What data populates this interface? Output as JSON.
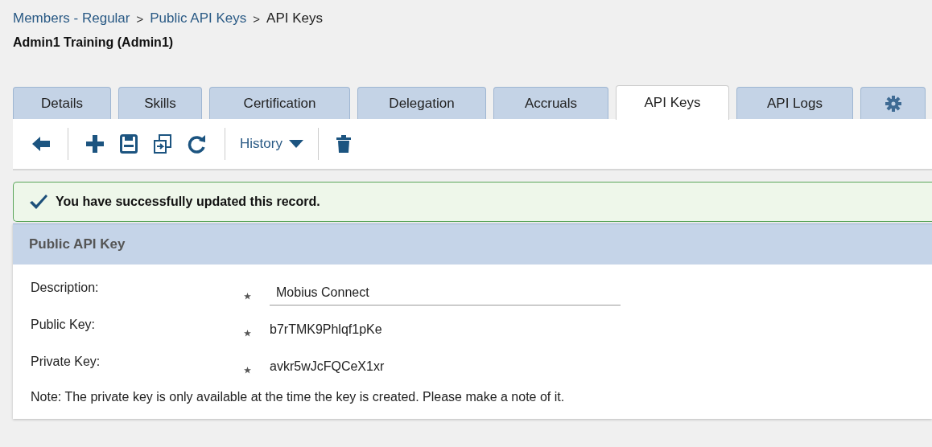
{
  "breadcrumb": [
    {
      "label": "Members - Regular",
      "link": true
    },
    {
      "label": "Public API Keys",
      "link": true
    },
    {
      "label": "API Keys",
      "link": false
    }
  ],
  "breadcrumb_separator": ">",
  "member_title": "Admin1 Training (Admin1)",
  "tabs": [
    {
      "kind": "text",
      "label": "Details",
      "selected": false
    },
    {
      "kind": "text",
      "label": "Skills",
      "selected": false
    },
    {
      "kind": "text",
      "label": "Certification",
      "selected": false
    },
    {
      "kind": "text",
      "label": "Delegation",
      "selected": false
    },
    {
      "kind": "text",
      "label": "Accruals",
      "selected": false
    },
    {
      "kind": "text",
      "label": "API Keys",
      "selected": true
    },
    {
      "kind": "text",
      "label": "API Logs",
      "selected": false
    },
    {
      "kind": "settings",
      "selected": false
    }
  ],
  "toolbar": [
    {
      "kind": "back"
    },
    {
      "kind": "separator"
    },
    {
      "kind": "add"
    },
    {
      "kind": "save"
    },
    {
      "kind": "save-copy"
    },
    {
      "kind": "refresh"
    },
    {
      "kind": "separator"
    },
    {
      "kind": "dropdown",
      "label": "History"
    },
    {
      "kind": "separator"
    },
    {
      "kind": "delete"
    }
  ],
  "alert": {
    "message": "You have successfully updated this record."
  },
  "panel": {
    "title": "Public API Key",
    "fields": [
      {
        "kind": "input",
        "label": "Description:",
        "required": true,
        "value": "Mobius Connect"
      },
      {
        "kind": "text",
        "label": "Public Key:",
        "required": true,
        "value": "b7rTMK9Phlqf1pKe"
      },
      {
        "kind": "text",
        "label": "Private Key:",
        "required": true,
        "value": "avkr5wJcFQCeX1xr"
      }
    ],
    "note": "Note: The private key is only available at the time the key is created. Please make a note of it."
  }
}
